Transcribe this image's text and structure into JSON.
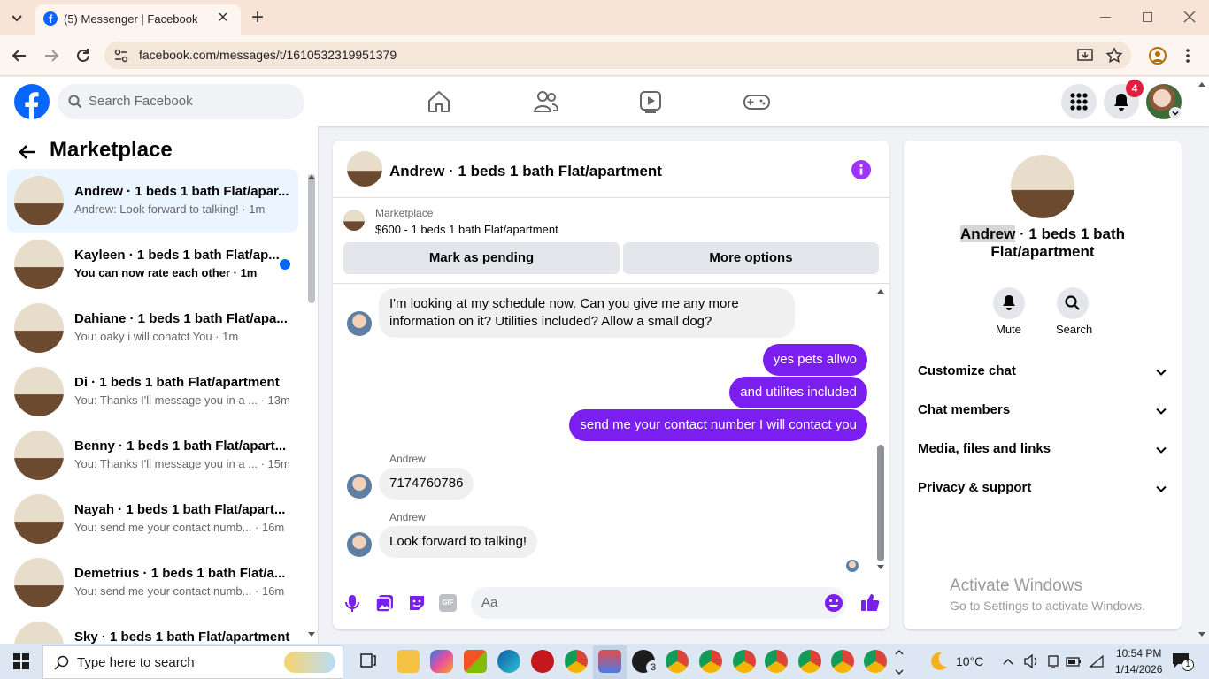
{
  "browser": {
    "tab_title": "(5) Messenger | Facebook",
    "url": "facebook.com/messages/t/1610532319951379",
    "new_tab": "+",
    "tab_close": "×"
  },
  "facebook": {
    "search_placeholder": "Search Facebook",
    "notification_count": "4",
    "brand_color": "#0866ff"
  },
  "sidebar": {
    "title": "Marketplace",
    "conversations": [
      {
        "title": "Andrew · 1 beds 1 bath Flat/apar...",
        "preview": "Andrew: Look forward to talking! · 1m",
        "active": true,
        "unread": false
      },
      {
        "title": "Kayleen · 1 beds 1 bath Flat/ap...",
        "preview": "You can now rate each other · 1m",
        "active": false,
        "unread": true
      },
      {
        "title": "Dahiane · 1 beds 1 bath Flat/apa...",
        "preview": "You: oaky i will conatct You · 1m",
        "active": false,
        "unread": false
      },
      {
        "title": "Di · 1 beds 1 bath Flat/apartment",
        "preview": "You: Thanks I'll message you in a ... · 13m",
        "active": false,
        "unread": false
      },
      {
        "title": "Benny · 1 beds 1 bath Flat/apart...",
        "preview": "You: Thanks I'll message you in a ... · 15m",
        "active": false,
        "unread": false
      },
      {
        "title": "Nayah · 1 beds 1 bath Flat/apart...",
        "preview": "You: send me your contact numb... · 16m",
        "active": false,
        "unread": false
      },
      {
        "title": "Demetrius · 1 beds 1 bath Flat/a...",
        "preview": "You: send me your contact numb... · 16m",
        "active": false,
        "unread": false
      },
      {
        "title": "Sky · 1 beds 1 bath Flat/apartment",
        "preview": "",
        "active": false,
        "unread": false
      }
    ]
  },
  "chat": {
    "title": "Andrew · 1 beds 1 bath Flat/apartment",
    "listing_source": "Marketplace",
    "listing_title": "$600 - 1 beds 1 bath Flat/apartment",
    "mark_pending": "Mark as pending",
    "more_options": "More options",
    "messages": {
      "m1": "I'm looking at my schedule now. Can you give me any more information on it? Utilities included? Allow a small dog?",
      "m2": "yes pets allwo",
      "m3": "and utilites included",
      "m4": "send me your contact number I will contact you",
      "m5_sender": "Andrew",
      "m5": "7174760786",
      "m6_sender": "Andrew",
      "m6": "Look forward to talking!"
    },
    "composer_placeholder": "Aa",
    "accent_color": "#7b1ef0"
  },
  "info_panel": {
    "name_highlight": "Andrew",
    "name_rest_line1": " · 1 beds 1 bath",
    "name_line2": "Flat/apartment",
    "mute_label": "Mute",
    "search_label": "Search",
    "sections": [
      "Customize chat",
      "Chat members",
      "Media, files and links",
      "Privacy & support"
    ]
  },
  "watermark": {
    "line1": "Activate Windows",
    "line2": "Go to Settings to activate Windows."
  },
  "taskbar": {
    "search_placeholder": "Type here to search",
    "weather": "10°C",
    "time": "10:54 PM",
    "date": "1/14/2026",
    "whatsapp_badge": "3",
    "notification_badge": "1"
  }
}
